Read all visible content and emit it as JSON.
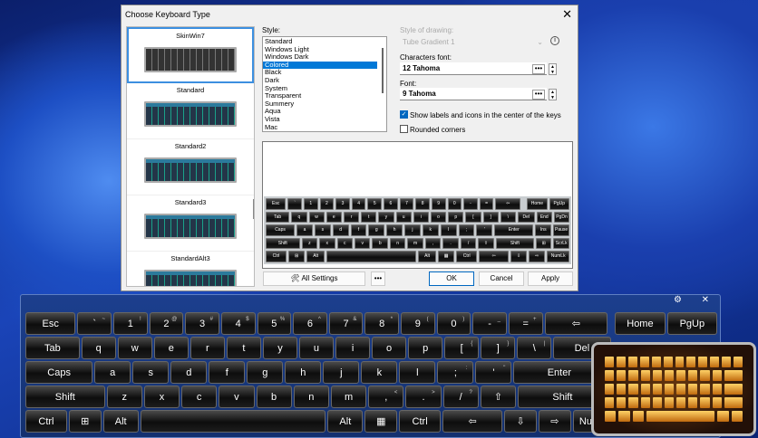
{
  "dialog": {
    "title": "Choose Keyboard Type",
    "close": "✕",
    "themes": [
      "SkinWin7",
      "Standard",
      "Standard2",
      "Standard3",
      "StandardAlt3"
    ],
    "style_label": "Style:",
    "styles": [
      "Standard",
      "Windows Light",
      "Windows Dark",
      "Colored",
      "Black",
      "Dark",
      "System",
      "Transparent",
      "Summery",
      "Aqua",
      "Vista",
      "Mac"
    ],
    "selected_style": "Colored",
    "drawing_label": "Style of drawing:",
    "drawing_value": "Tube Gradient 1",
    "chars_font_label": "Characters font:",
    "chars_font_value": "12 Tahoma",
    "font_label": "Font:",
    "font_value": "9 Tahoma",
    "show_labels": "Show labels and icons in the center of the keys",
    "show_labels_checked": true,
    "rounded": "Rounded corners",
    "rounded_checked": false,
    "all_settings": "All Settings",
    "more": "•••",
    "ok": "OK",
    "cancel": "Cancel",
    "apply": "Apply"
  },
  "mini_keyboard": {
    "rows": [
      [
        "Esc",
        "`",
        "1",
        "2",
        "3",
        "4",
        "5",
        "6",
        "7",
        "8",
        "9",
        "0",
        "-",
        "=",
        "⇦",
        "Home",
        "PgUp"
      ],
      [
        "Tab",
        "q",
        "w",
        "e",
        "r",
        "t",
        "y",
        "u",
        "i",
        "o",
        "p",
        "[",
        "]",
        "\\",
        "Del",
        "End",
        "PgDn"
      ],
      [
        "Caps",
        "a",
        "s",
        "d",
        "f",
        "g",
        "h",
        "j",
        "k",
        "l",
        ";",
        "'",
        "Enter",
        "Ins",
        "Pause"
      ],
      [
        "Shift",
        "z",
        "x",
        "c",
        "v",
        "b",
        "n",
        "m",
        ",",
        ".",
        "/",
        "⇧",
        "Shift",
        "⊞",
        "ScrLk"
      ],
      [
        "Ctrl",
        "⊞",
        "Alt",
        "",
        "Alt",
        "▦",
        "Ctrl",
        "⇦",
        "⇩",
        "⇨",
        "NumLk"
      ]
    ]
  },
  "keyboard": {
    "settings": "⚙",
    "close": "✕",
    "rows": [
      [
        [
          "Esc",
          ""
        ],
        [
          "`",
          "~"
        ],
        [
          "1",
          "!"
        ],
        [
          "2",
          "@"
        ],
        [
          "3",
          "#"
        ],
        [
          "4",
          "$"
        ],
        [
          "5",
          "%"
        ],
        [
          "6",
          "^"
        ],
        [
          "7",
          "&"
        ],
        [
          "8",
          "*"
        ],
        [
          "9",
          "("
        ],
        [
          "0",
          ")"
        ],
        [
          "-",
          "_"
        ],
        [
          "=",
          "+"
        ],
        [
          "⇦",
          ""
        ],
        [
          "Home",
          ""
        ],
        [
          "PgUp",
          ""
        ]
      ],
      [
        [
          "Tab",
          ""
        ],
        [
          "q",
          ""
        ],
        [
          "w",
          ""
        ],
        [
          "e",
          ""
        ],
        [
          "r",
          ""
        ],
        [
          "t",
          ""
        ],
        [
          "y",
          ""
        ],
        [
          "u",
          ""
        ],
        [
          "i",
          ""
        ],
        [
          "o",
          ""
        ],
        [
          "p",
          ""
        ],
        [
          "[",
          "{"
        ],
        [
          "]",
          "}"
        ],
        [
          "\\",
          "|"
        ],
        [
          "Del",
          ""
        ]
      ],
      [
        [
          "Caps",
          ""
        ],
        [
          "a",
          ""
        ],
        [
          "s",
          ""
        ],
        [
          "d",
          ""
        ],
        [
          "f",
          ""
        ],
        [
          "g",
          ""
        ],
        [
          "h",
          ""
        ],
        [
          "j",
          ""
        ],
        [
          "k",
          ""
        ],
        [
          "l",
          ""
        ],
        [
          ";",
          ":"
        ],
        [
          "'",
          "\""
        ],
        [
          "Enter",
          ""
        ]
      ],
      [
        [
          "Shift",
          ""
        ],
        [
          "z",
          ""
        ],
        [
          "x",
          ""
        ],
        [
          "c",
          ""
        ],
        [
          "v",
          ""
        ],
        [
          "b",
          ""
        ],
        [
          "n",
          ""
        ],
        [
          "m",
          ""
        ],
        [
          ",",
          "<"
        ],
        [
          ".",
          ">"
        ],
        [
          "/",
          "?"
        ],
        [
          "⇧",
          ""
        ],
        [
          "Shift",
          ""
        ]
      ],
      [
        [
          "Ctrl",
          ""
        ],
        [
          "⊞",
          ""
        ],
        [
          "Alt",
          ""
        ],
        [
          "",
          ""
        ],
        [
          "Alt",
          ""
        ],
        [
          "▦",
          ""
        ],
        [
          "Ctrl",
          ""
        ],
        [
          "⇦",
          ""
        ],
        [
          "⇩",
          ""
        ],
        [
          "⇨",
          ""
        ],
        [
          "NumLk",
          ""
        ]
      ]
    ]
  },
  "colors": {
    "accent": "#0078d7",
    "kb_bg": "#1c3f8e"
  }
}
